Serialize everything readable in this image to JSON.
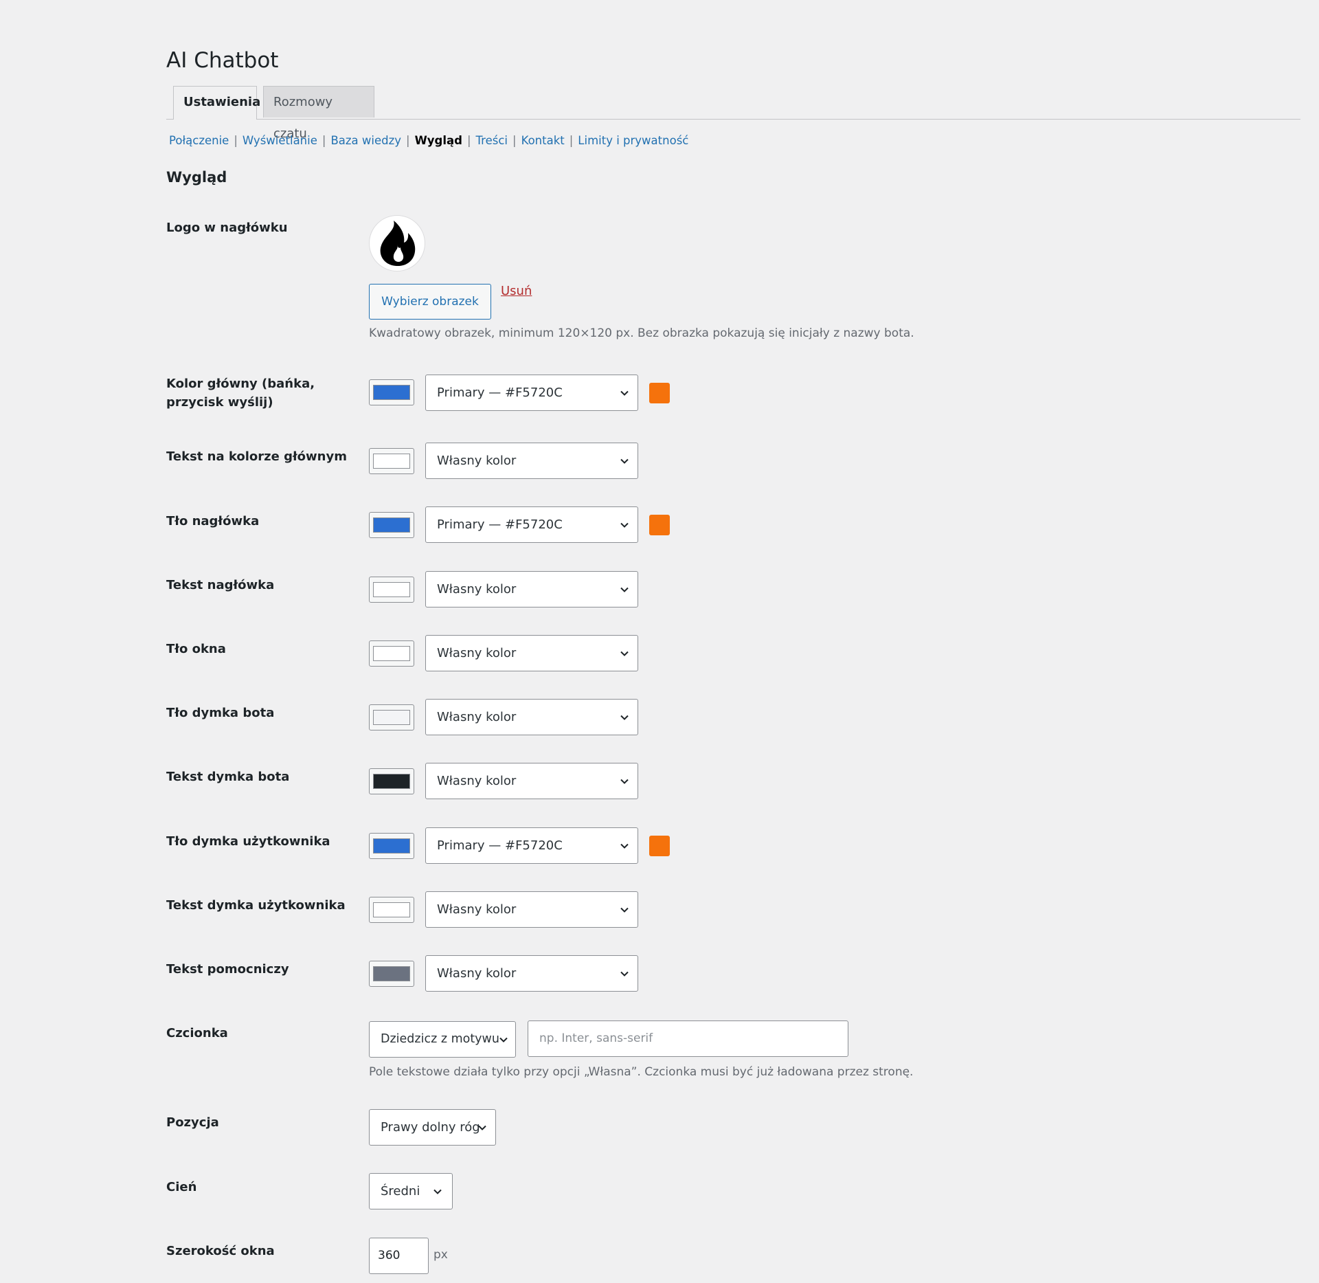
{
  "page": {
    "title": "AI Chatbot"
  },
  "tabs": [
    {
      "label": "Ustawienia",
      "active": true
    },
    {
      "label": "Rozmowy czatu",
      "active": false
    }
  ],
  "subnav": [
    {
      "label": "Połączenie",
      "current": false
    },
    {
      "label": "Wyświetlanie",
      "current": false
    },
    {
      "label": "Baza wiedzy",
      "current": false
    },
    {
      "label": "Wygląd",
      "current": true
    },
    {
      "label": "Treści",
      "current": false
    },
    {
      "label": "Kontakt",
      "current": false
    },
    {
      "label": "Limity i prywatność",
      "current": false
    }
  ],
  "section": {
    "title": "Wygląd"
  },
  "logo": {
    "label": "Logo w nagłówku",
    "icon": "flame-icon",
    "choose_label": "Wybierz obrazek",
    "remove_label": "Usuń",
    "description": "Kwadratowy obrazek, minimum 120×120 px. Bez obrazka pokazują się inicjały z nazwy bota."
  },
  "colors": [
    {
      "label": "Kolor główny (bańka, przycisk wyślij)",
      "swatch": "#2c6fd1",
      "select": "Primary — #F5720C",
      "preview": "#f5720c"
    },
    {
      "label": "Tekst na kolorze głównym",
      "swatch": "#ffffff",
      "select": "Własny kolor",
      "preview": null
    },
    {
      "label": "Tło nagłówka",
      "swatch": "#2c6fd1",
      "select": "Primary — #F5720C",
      "preview": "#f5720c"
    },
    {
      "label": "Tekst nagłówka",
      "swatch": "#ffffff",
      "select": "Własny kolor",
      "preview": null
    },
    {
      "label": "Tło okna",
      "swatch": "#ffffff",
      "select": "Własny kolor",
      "preview": null
    },
    {
      "label": "Tło dymka bota",
      "swatch": "#f3f4f6",
      "select": "Własny kolor",
      "preview": null
    },
    {
      "label": "Tekst dymka bota",
      "swatch": "#1d2327",
      "select": "Własny kolor",
      "preview": null
    },
    {
      "label": "Tło dymka użytkownika",
      "swatch": "#2c6fd1",
      "select": "Primary — #F5720C",
      "preview": "#f5720c"
    },
    {
      "label": "Tekst dymka użytkownika",
      "swatch": "#ffffff",
      "select": "Własny kolor",
      "preview": null
    },
    {
      "label": "Tekst pomocniczy",
      "swatch": "#6b7280",
      "select": "Własny kolor",
      "preview": null
    }
  ],
  "font": {
    "label": "Czcionka",
    "select": "Dziedzicz z motywu",
    "input_value": "",
    "input_placeholder": "np. Inter, sans-serif",
    "description": "Pole tekstowe działa tylko przy opcji „Własna”. Czcionka musi być już ładowana przez stronę."
  },
  "position": {
    "label": "Pozycja",
    "select": "Prawy dolny róg"
  },
  "shadow": {
    "label": "Cień",
    "select": "Średni"
  },
  "width": {
    "label": "Szerokość okna",
    "value": "360",
    "unit": "px"
  }
}
